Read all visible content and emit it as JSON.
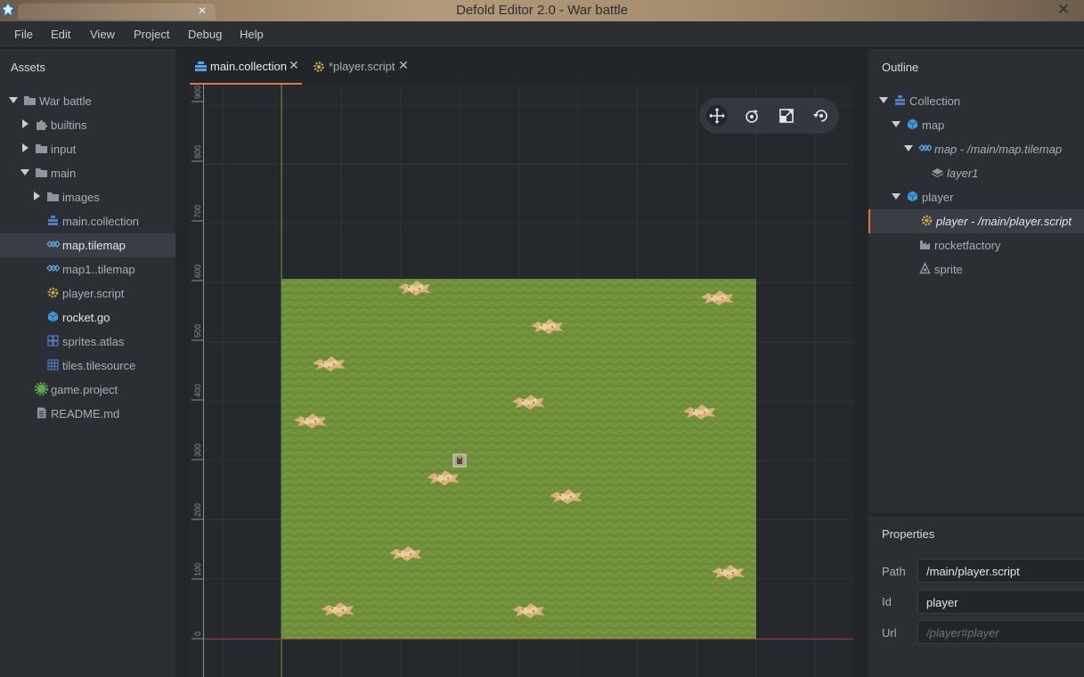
{
  "window": {
    "title": "Defold Editor 2.0 - War battle",
    "close_glyph": "✕",
    "background_tab_close": "✕"
  },
  "menu": [
    "File",
    "Edit",
    "View",
    "Project",
    "Debug",
    "Help"
  ],
  "assets": {
    "header": "Assets",
    "items": [
      {
        "label": "War battle",
        "icon": "folder-icon",
        "expanded": true
      },
      {
        "label": "builtins",
        "icon": "puzzle-icon",
        "expanded": false
      },
      {
        "label": "input",
        "icon": "folder-icon",
        "expanded": false
      },
      {
        "label": "main",
        "icon": "folder-icon",
        "expanded": true
      },
      {
        "label": "images",
        "icon": "folder-icon",
        "expanded": false
      },
      {
        "label": "main.collection",
        "icon": "collection-icon"
      },
      {
        "label": "map.tilemap",
        "icon": "tilemap-icon",
        "selected": true
      },
      {
        "label": "map1..tilemap",
        "icon": "tilemap-icon"
      },
      {
        "label": "player.script",
        "icon": "gear-icon"
      },
      {
        "label": "rocket.go",
        "icon": "cube-icon"
      },
      {
        "label": "sprites.atlas",
        "icon": "atlas-icon"
      },
      {
        "label": "tiles.tilesource",
        "icon": "tilesource-icon"
      },
      {
        "label": "game.project",
        "icon": "game-project-icon"
      },
      {
        "label": "README.md",
        "icon": "document-icon"
      }
    ]
  },
  "editor": {
    "tabs": [
      {
        "label": "main.collection",
        "active": true,
        "close": "✕"
      },
      {
        "label": "*player.script",
        "active": false,
        "close": "✕"
      }
    ],
    "ruler_ticks": [
      "900",
      "800",
      "700",
      "600",
      "500",
      "400",
      "300",
      "200",
      "100",
      "0"
    ],
    "tools": [
      "move-icon",
      "rotate-icon",
      "scale-icon",
      "camera-reset-icon"
    ]
  },
  "outline": {
    "header": "Outline",
    "items": [
      {
        "label": "Collection",
        "icon": "collection-icon",
        "expanded": true
      },
      {
        "label": "map",
        "icon": "cube-icon",
        "expanded": true
      },
      {
        "label": "map - /main/map.tilemap",
        "icon": "tilemap-icon",
        "expanded": true,
        "italic": true
      },
      {
        "label": "layer1",
        "icon": "layer-icon",
        "italic": true
      },
      {
        "label": "player",
        "icon": "cube-icon",
        "expanded": true
      },
      {
        "label": "player - /main/player.script",
        "icon": "gear-icon",
        "italic": true,
        "selected": true
      },
      {
        "label": "rocketfactory",
        "icon": "factory-icon"
      },
      {
        "label": "sprite",
        "icon": "sprite-icon"
      }
    ]
  },
  "properties": {
    "header": "Properties",
    "path_label": "Path",
    "path_value": "/main/player.script",
    "id_label": "Id",
    "id_value": "player",
    "url_label": "Url",
    "url_value": "/player#player"
  },
  "colors": {
    "accent": "#e8763c",
    "grass": "#6f8f3a",
    "panel": "#2b2e33",
    "background": "#22252a",
    "y_axis": "#4fa33a",
    "x_axis": "#b02a2a"
  }
}
